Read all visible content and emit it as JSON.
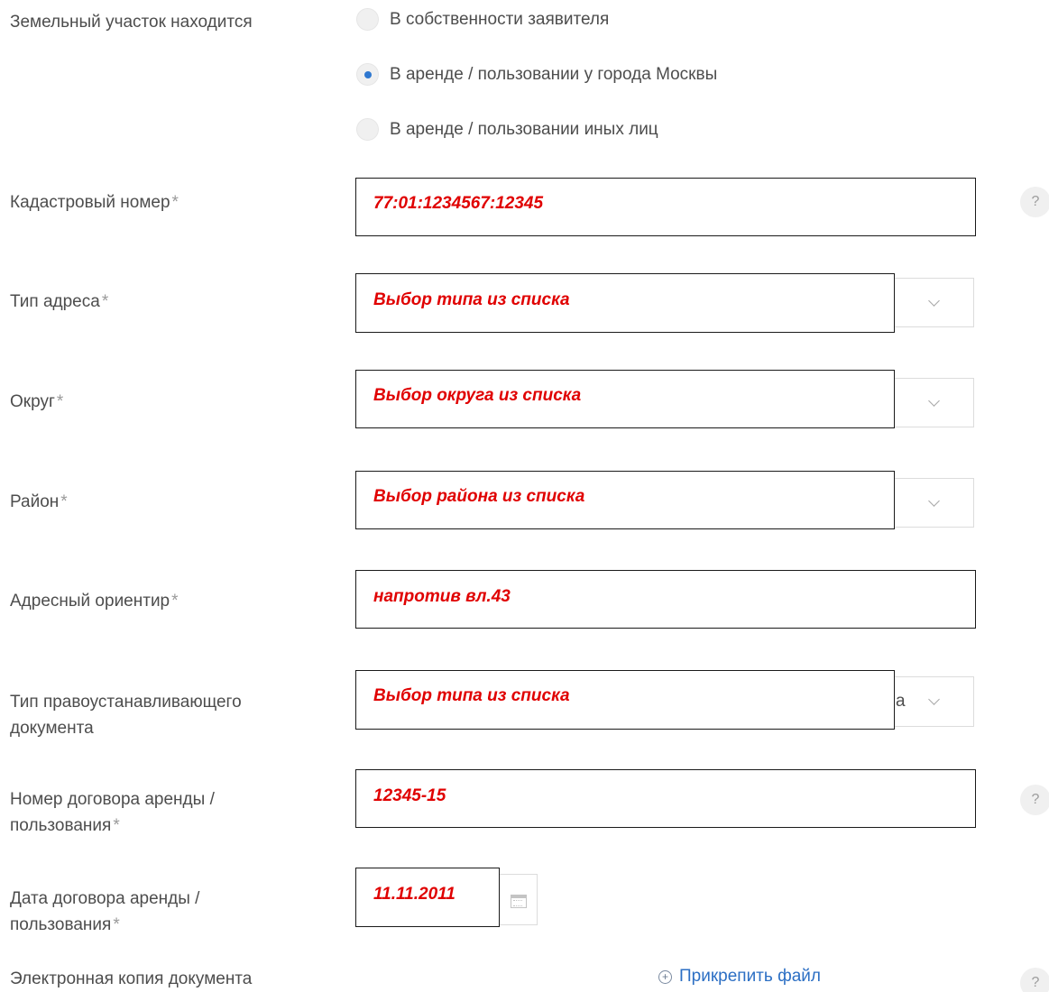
{
  "land": {
    "label": "Земельный участок находится",
    "options": [
      {
        "label": "В собственности заявителя",
        "checked": false
      },
      {
        "label": "В аренде / пользовании у города Москвы",
        "checked": true
      },
      {
        "label": "В аренде / пользовании иных лиц",
        "checked": false
      }
    ]
  },
  "cadastral": {
    "label": "Кадастровый номер",
    "required": "*",
    "value": "77:01:1234567:12345"
  },
  "address_type": {
    "label": "Тип адреса",
    "required": "*",
    "value": "Выбор типа из списка"
  },
  "okrug": {
    "label": "Округ",
    "required": "*",
    "value": "Выбор округа из списка"
  },
  "rayon": {
    "label": "Район",
    "required": "*",
    "value": "Выбор района из списка"
  },
  "landmark": {
    "label": "Адресный ориентир",
    "required": "*",
    "value": "напротив вл.43"
  },
  "doc_type": {
    "label_line1": "Тип правоустанавливающего",
    "label_line2": "документа",
    "value": "Выбор типа из списка",
    "peek": "а"
  },
  "contract_number": {
    "label_line1": "Номер договора аренды /",
    "label_line2": "пользования",
    "required": "*",
    "value": "12345-15"
  },
  "contract_date": {
    "label_line1": "Дата договора аренды /",
    "label_line2": "пользования",
    "required": "*",
    "value": "11.11.2011"
  },
  "e_copy": {
    "label": "Электронная копия документа",
    "attach_label": "Прикрепить файл",
    "attach_icon": "plus-circle-icon"
  },
  "help_glyph": "?",
  "colors": {
    "value_text": "#e00000",
    "link": "#2c6fc4",
    "radio_checked": "#2f78d0"
  }
}
